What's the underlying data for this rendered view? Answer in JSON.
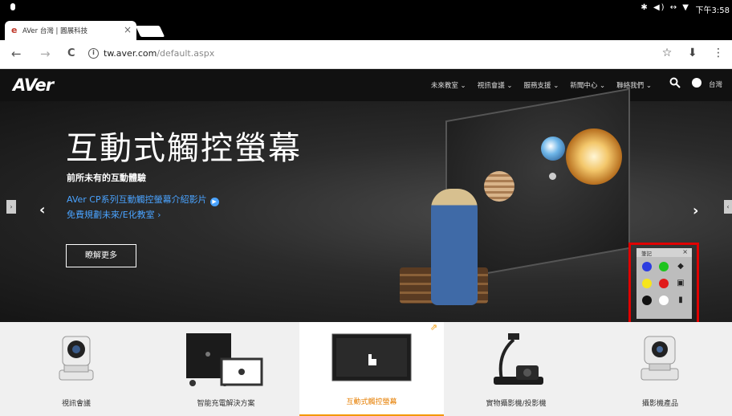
{
  "status_bar": {
    "icons": "✱ ◀) ↔ ▼",
    "time": "下午3:58"
  },
  "browser": {
    "tab": {
      "favicon": "e",
      "title": "AVer 台灣 | 圓展科技",
      "close": "×"
    },
    "nav": {
      "back": "←",
      "forward": "→",
      "reload": "C"
    },
    "info_icon": "i",
    "url_host": "tw.aver.com",
    "url_path": "/default.aspx",
    "actions": {
      "bookmark": "☆",
      "download": "⬇",
      "menu": "⋮"
    }
  },
  "site_header": {
    "logo": "AVer",
    "menu": [
      {
        "label": "未來教室 ⌄"
      },
      {
        "label": "視訊會議 ⌄"
      },
      {
        "label": "服務支援 ⌄"
      },
      {
        "label": "新聞中心 ⌄"
      },
      {
        "label": "聯絡我們 ⌄"
      }
    ],
    "region": "台灣"
  },
  "hero": {
    "title": "互動式觸控螢幕",
    "subtitle": "前所未有的互動體驗",
    "link1": "AVer CP系列互動觸控螢幕介紹影片",
    "link1_icon": "▶",
    "link2": "免費規劃未來/E化教室 ›",
    "button": "瞭解更多",
    "arrow_left_edge": "›",
    "arrow_left": "‹",
    "arrow_right": "›",
    "arrow_right_edge": "‹"
  },
  "palette": {
    "title": "筆記",
    "close": "×",
    "colors": [
      "#2d3de0",
      "#1ec41e",
      "#f6e51c",
      "#e11a1a",
      "#111111",
      "#ffffff"
    ],
    "tools": {
      "eraser": "◆",
      "save": "▣",
      "delete": "▮"
    }
  },
  "categories": [
    {
      "label": "視訊會議"
    },
    {
      "label": "智能充電解決方案"
    },
    {
      "label": "互動式觸控螢幕",
      "active": true,
      "ext_icon": "⇗"
    },
    {
      "label": "實物攝影機/投影機"
    },
    {
      "label": "攝影機產品"
    }
  ]
}
